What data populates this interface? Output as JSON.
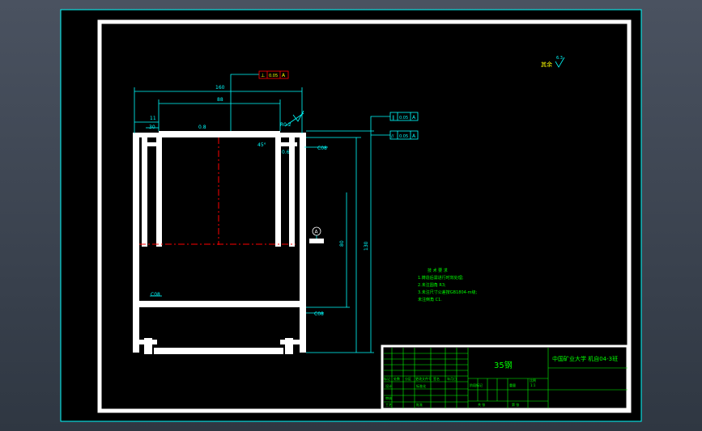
{
  "drawing": {
    "colors": {
      "background": "#000000",
      "frame": "#ffffff",
      "dimension": "#00ffff",
      "annotation": "#00ff00",
      "title_block": "#00ff00",
      "centerline": "#ff0000",
      "viewport_bg": "#3a4350"
    },
    "dimensions": {
      "overall_width": "160",
      "inner_width": "88",
      "left_small": "11",
      "left_step": "30",
      "chamfer_left": "0.8",
      "radius_right": "R0.2",
      "angle": "45°",
      "flat_label": "0.6",
      "height_total": "130",
      "height_inner": "80",
      "side_note_1": "C08",
      "side_note_2": "C08",
      "lower_note": "C08"
    },
    "tolerance_frames": {
      "top": {
        "symbol": "⊥",
        "value": "0.05",
        "datum": "A"
      },
      "right_1": {
        "symbol": "∥",
        "value": "0.05",
        "datum": "A"
      },
      "right_2": {
        "symbol": "//",
        "value": "0.05",
        "datum": "A"
      }
    },
    "datum_label": "A",
    "roughness": {
      "label": "其余",
      "value": "6.3"
    },
    "tech_requirements": {
      "heading": "技 术 要 求",
      "lines": [
        "1.铸造后需进行时效处理;",
        "2.未注圆角 R3;",
        "3.未注尺寸公差按GB1804-m级;",
        "  未注倒角 C1."
      ]
    },
    "title_block": {
      "material": "35钢",
      "school": "中国矿业大学 机自04-3班",
      "scale": "1:1",
      "row_labels": [
        "标记",
        "处数",
        "分区",
        "更改文件号",
        "签名",
        "年月日"
      ],
      "row2_labels": [
        "设计",
        "标准化",
        "阶段标记",
        "重量",
        "比例"
      ],
      "row3_labels": [
        "审核",
        "工艺",
        "批准",
        "共 张",
        "第 张"
      ]
    }
  }
}
